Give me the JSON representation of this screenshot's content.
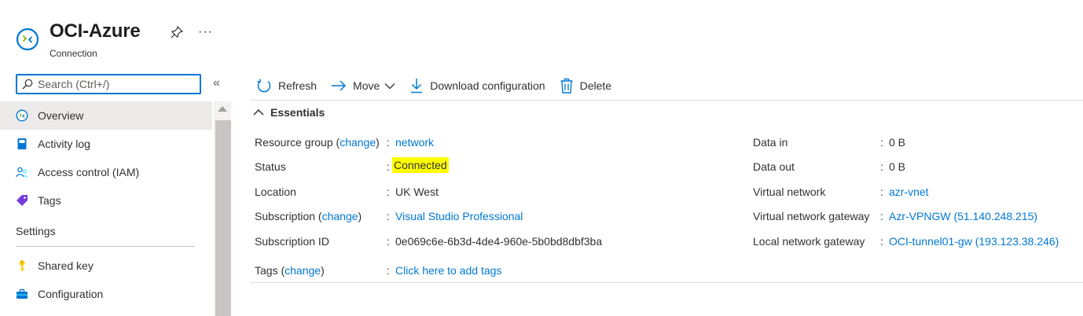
{
  "header": {
    "title": "OCI-Azure",
    "subtitle": "Connection",
    "more_label": "···"
  },
  "sidebar": {
    "search_placeholder": "Search (Ctrl+/)",
    "collapse_label": "«",
    "items": [
      {
        "label": "Overview",
        "icon": "connection-icon"
      },
      {
        "label": "Activity log",
        "icon": "activity-log-icon"
      },
      {
        "label": "Access control (IAM)",
        "icon": "people-icon"
      },
      {
        "label": "Tags",
        "icon": "tag-icon"
      }
    ],
    "settings_header": "Settings",
    "settings_items": [
      {
        "label": "Shared key",
        "icon": "key-icon"
      },
      {
        "label": "Configuration",
        "icon": "toolbox-icon"
      }
    ]
  },
  "toolbar": {
    "refresh": "Refresh",
    "move": "Move",
    "download": "Download configuration",
    "delete": "Delete"
  },
  "essentials": {
    "title": "Essentials",
    "left": [
      {
        "label": "Resource group",
        "change": "change",
        "value": "network",
        "link": true
      },
      {
        "label": "Status",
        "value": "Connected",
        "highlight": true
      },
      {
        "label": "Location",
        "value": "UK West"
      },
      {
        "label": "Subscription",
        "change": "change",
        "value": "Visual Studio Professional",
        "link": true
      },
      {
        "label": "Subscription ID",
        "value": "0e069c6e-6b3d-4de4-960e-5b0bd8dbf3ba"
      }
    ],
    "tags_label": "Tags",
    "tags_change": "change",
    "tags_value": "Click here to add tags",
    "right": [
      {
        "label": "Data in",
        "value": "0 B"
      },
      {
        "label": "Data out",
        "value": "0 B"
      },
      {
        "label": "Virtual network",
        "value": "azr-vnet",
        "link": true
      },
      {
        "label": "Virtual network gateway",
        "value": "Azr-VPNGW (51.140.248.215)",
        "link": true
      },
      {
        "label": "Local network gateway",
        "value": "OCI-tunnel01-gw (193.123.38.246)",
        "link": true
      }
    ]
  },
  "colors": {
    "accent": "#0078d4",
    "highlight": "#ffff00"
  }
}
